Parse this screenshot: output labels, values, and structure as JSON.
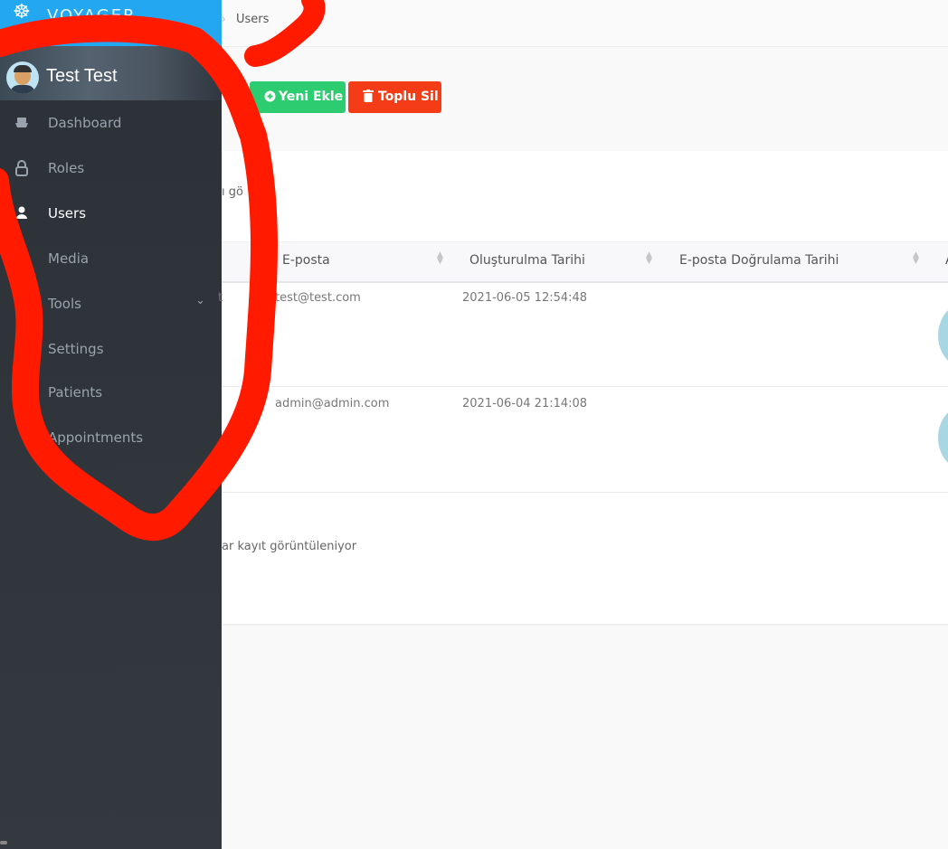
{
  "brand": {
    "name": "VOYAGER"
  },
  "user": {
    "name": "Test Test"
  },
  "sidebar": {
    "items": [
      {
        "label": "Dashboard",
        "icon": "boat-icon"
      },
      {
        "label": "Roles",
        "icon": "lock-icon"
      },
      {
        "label": "Users",
        "icon": "person-icon",
        "active": true
      },
      {
        "label": "Media",
        "icon": "image-icon"
      },
      {
        "label": "Tools",
        "icon": "hammer-icon",
        "has_submenu": true
      },
      {
        "label": "Settings",
        "icon": "gear-icon"
      },
      {
        "label": "Patients",
        "icon": ""
      },
      {
        "label": "Appointments",
        "icon": ""
      }
    ]
  },
  "breadcrumb": {
    "current": "Users"
  },
  "toolbar": {
    "add_label": "Yeni Ekle",
    "bulk_delete_label": "Toplu Sil"
  },
  "table": {
    "length_text_fragment": "ı gö",
    "columns": [
      "E-posta",
      "Oluşturulma Tarihi",
      "E-posta Doğrulama Tarihi",
      "A"
    ],
    "rows": [
      {
        "name_fragment": "t",
        "email": "test@test.com",
        "created_at": "2021-06-05 12:54:48",
        "verified_at": ""
      },
      {
        "name_fragment": "",
        "email": "admin@admin.com",
        "created_at": "2021-06-04 21:14:08",
        "verified_at": ""
      }
    ],
    "info_fragment": "ar kayıt görüntüleniyor"
  },
  "colors": {
    "brand_bar": "#22a7f0",
    "sidebar_bg": "#2b3137",
    "add_button": "#2ecc71",
    "delete_button": "#f43c16",
    "annotation": "#ff1a00"
  }
}
